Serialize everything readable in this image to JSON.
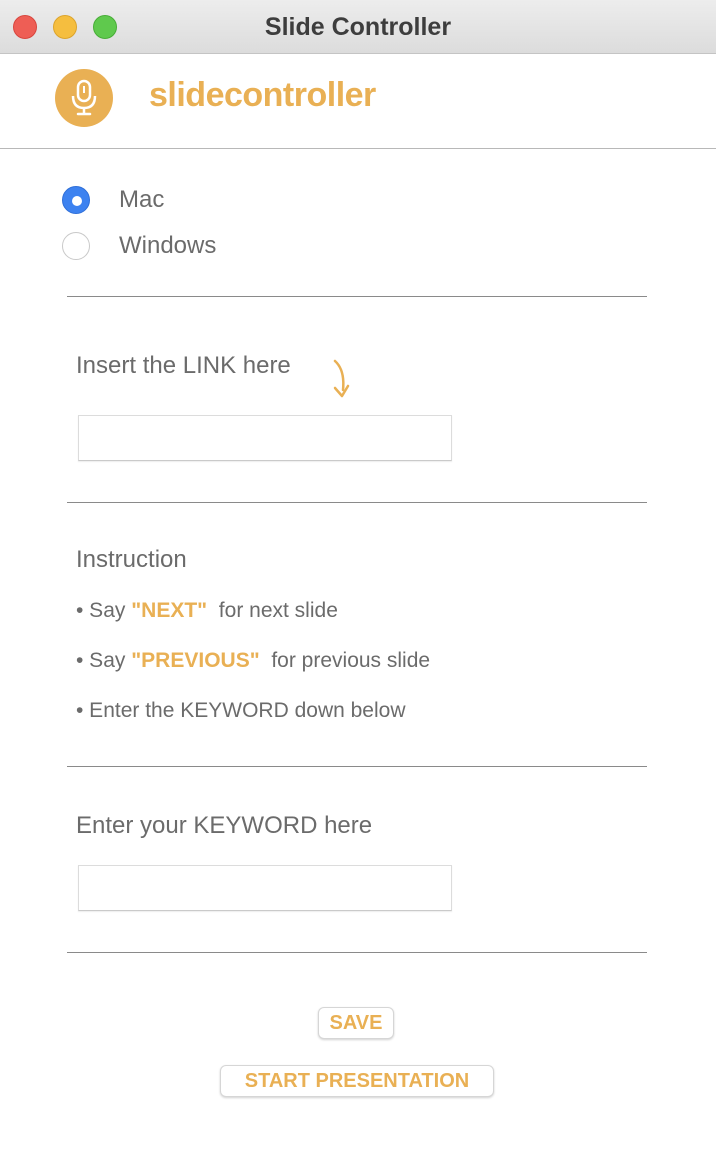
{
  "window": {
    "title": "Slide Controller"
  },
  "header": {
    "brand": "slidecontroller",
    "logo_icon": "microphone-icon"
  },
  "os_options": [
    {
      "label": "Mac",
      "selected": true
    },
    {
      "label": "Windows",
      "selected": false
    }
  ],
  "link_section": {
    "label": "Insert the LINK here",
    "value": ""
  },
  "instructions": {
    "title": "Instruction",
    "items": [
      {
        "prefix": "• Say ",
        "keyword": "\"NEXT\"",
        "suffix": "  for next slide"
      },
      {
        "prefix": "• Say ",
        "keyword": "\"PREVIOUS\"",
        "suffix": "  for previous slide"
      },
      {
        "prefix": "• Enter the KEYWORD down below",
        "keyword": "",
        "suffix": ""
      }
    ]
  },
  "keyword_section": {
    "label": "Enter your KEYWORD here",
    "value": ""
  },
  "buttons": {
    "save": "SAVE",
    "start": "START PRESENTATION"
  },
  "colors": {
    "accent": "#e9b054",
    "radio_selected": "#3d82f0",
    "text": "#6b6b6b"
  }
}
